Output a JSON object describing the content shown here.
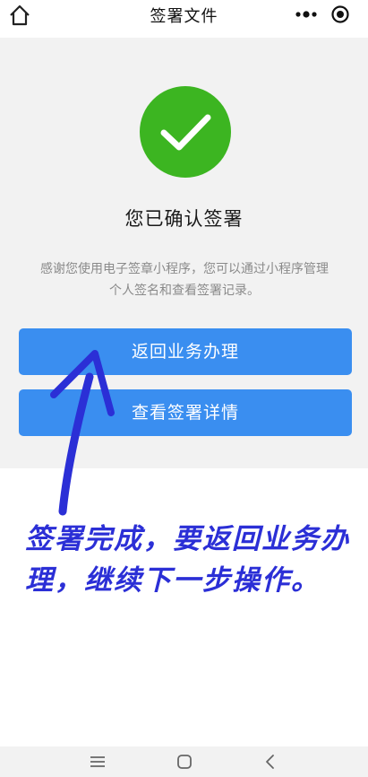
{
  "navbar": {
    "title": "签署文件",
    "home_icon": "home-icon",
    "more_icon": "more-dots-icon",
    "target_icon": "target-icon"
  },
  "result": {
    "icon": "checkmark-circle-icon",
    "icon_color": "#3cb521",
    "title": "您已确认签署",
    "description": "感谢您使用电子签章小程序，您可以通过小程序管理个人签名和查看签署记录。"
  },
  "actions": {
    "return_label": "返回业务办理",
    "view_label": "查看签署详情",
    "button_color": "#3a8ef0"
  },
  "annotation": {
    "text": "签署完成，要返回业务办理，继续下一步操作。",
    "color": "#2b2fd6"
  },
  "system_nav": {
    "menu_icon": "menu-icon",
    "home_icon": "circle-home-icon",
    "back_icon": "back-chevron-icon"
  }
}
